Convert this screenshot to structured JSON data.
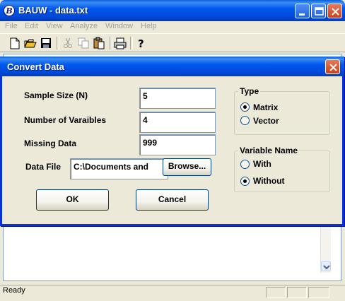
{
  "app": {
    "title": "BAUW - data.txt",
    "icon_letter": "B"
  },
  "menu": [
    "File",
    "Edit",
    "View",
    "Analyze",
    "Window",
    "Help"
  ],
  "toolbar": {
    "icons": [
      "new-document-icon",
      "open-folder-icon",
      "save-icon",
      "cut-icon",
      "copy-icon",
      "paste-icon",
      "print-icon",
      "help-icon"
    ]
  },
  "status": {
    "text": "Ready"
  },
  "dialog": {
    "title": "Convert Data",
    "fields": {
      "sample_size": {
        "label": "Sample Size (N)",
        "value": "5"
      },
      "num_variables": {
        "label": "Number of Varaibles",
        "value": "4"
      },
      "missing_data": {
        "label": "Missing Data",
        "value": "999"
      },
      "data_file": {
        "label": "Data File",
        "value": "C:\\Documents and"
      }
    },
    "browse_label": "Browse...",
    "ok_label": "OK",
    "cancel_label": "Cancel",
    "type_group": {
      "label": "Type",
      "options": [
        {
          "label": "Matrix",
          "checked": true
        },
        {
          "label": "Vector",
          "checked": false
        }
      ]
    },
    "varname_group": {
      "label": "Variable Name",
      "options": [
        {
          "label": "With",
          "checked": false
        },
        {
          "label": "Without",
          "checked": true
        }
      ]
    }
  }
}
